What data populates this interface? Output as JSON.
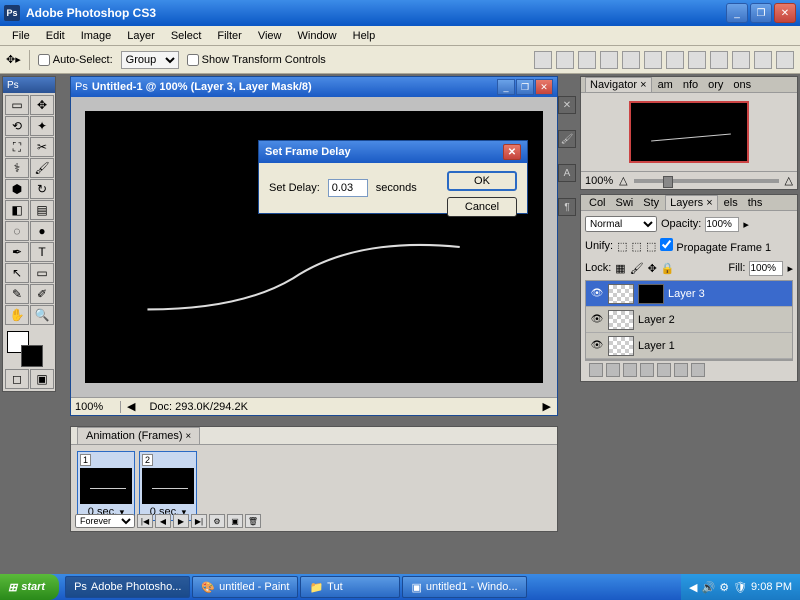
{
  "app": {
    "title": "Adobe Photoshop CS3"
  },
  "menu": [
    "File",
    "Edit",
    "Image",
    "Layer",
    "Select",
    "Filter",
    "View",
    "Window",
    "Help"
  ],
  "options": {
    "auto_select": "Auto-Select:",
    "group": "Group",
    "show_transform": "Show Transform Controls"
  },
  "tools_header": "Ps",
  "document": {
    "title": "Untitled-1 @ 100% (Layer 3, Layer Mask/8)",
    "zoom": "100%",
    "doc_info": "Doc: 293.0K/294.2K"
  },
  "dialog": {
    "title": "Set Frame Delay",
    "label": "Set Delay:",
    "value": "0.03",
    "unit": "seconds",
    "ok": "OK",
    "cancel": "Cancel"
  },
  "animation": {
    "title": "Animation (Frames)",
    "frames": [
      {
        "num": "1",
        "delay": "0 sec."
      },
      {
        "num": "2",
        "delay": "0 sec."
      }
    ],
    "loop": "Forever"
  },
  "navigator": {
    "tabs": [
      "Navigator",
      "am",
      "nfo",
      "ory",
      "ons"
    ],
    "zoom": "100%"
  },
  "layers_panel": {
    "tabs": [
      "Col",
      "Swi",
      "Sty",
      "Layers",
      "els",
      "ths"
    ],
    "blend": "Normal",
    "opacity_lbl": "Opacity:",
    "opacity": "100%",
    "unify": "Unify:",
    "propagate": "Propagate Frame 1",
    "lock": "Lock:",
    "fill_lbl": "Fill:",
    "fill": "100%",
    "layers": [
      {
        "name": "Layer 3",
        "sel": true,
        "mask": true
      },
      {
        "name": "Layer 2",
        "sel": false,
        "mask": false
      },
      {
        "name": "Layer 1",
        "sel": false,
        "mask": false
      }
    ]
  },
  "taskbar": {
    "start": "start",
    "tasks": [
      "Adobe Photosho...",
      "untitled - Paint",
      "Tut",
      "untitled1 - Windo..."
    ],
    "time": "9:08 PM"
  }
}
